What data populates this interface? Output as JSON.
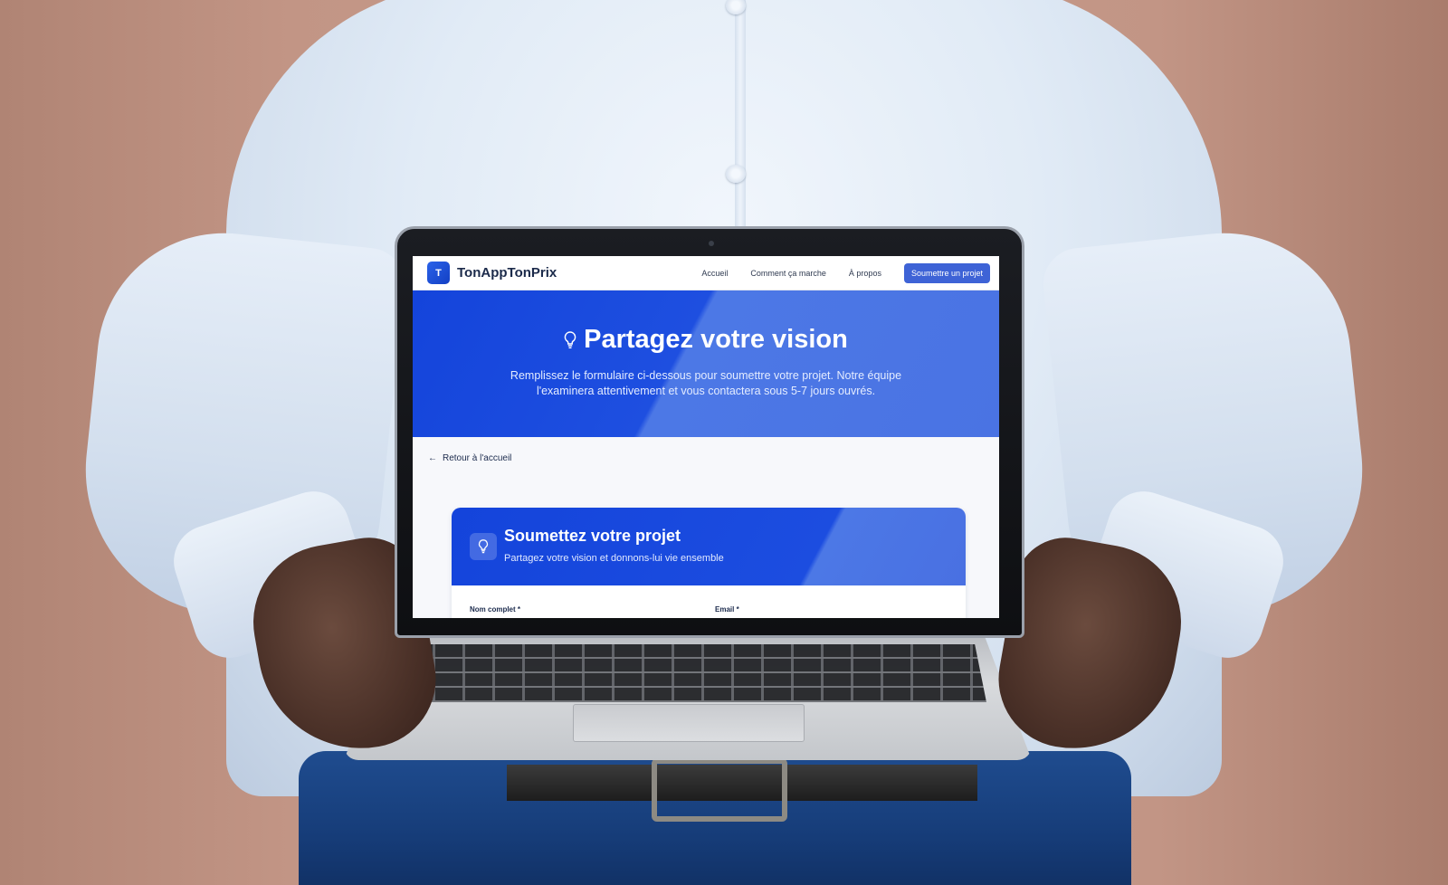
{
  "site": {
    "logo_letter": "T",
    "brand_name": "TonAppTonPrix"
  },
  "nav": {
    "items": [
      {
        "label": "Accueil"
      },
      {
        "label": "Comment ça marche"
      },
      {
        "label": "À propos"
      }
    ],
    "cta_label": "Soumettre un projet"
  },
  "hero": {
    "icon": "lightbulb-icon",
    "title": "Partagez votre vision",
    "description_line1": "Remplissez le formulaire ci-dessous pour soumettre votre projet. Notre équipe",
    "description_line2": "l'examinera attentivement et vous contactera sous 5-7 jours ouvrés."
  },
  "back_link": {
    "label": "Retour à l'accueil"
  },
  "form": {
    "icon": "lightbulb-icon",
    "title": "Soumettez votre projet",
    "subtitle": "Partagez votre vision et donnons-lui vie ensemble",
    "fields": [
      {
        "label": "Nom complet *"
      },
      {
        "label": "Email *"
      }
    ]
  },
  "colors": {
    "primary": "#1444db",
    "primary_light": "#4c78e6",
    "cta": "#3e63d6",
    "text_dark": "#1b2a4a"
  }
}
